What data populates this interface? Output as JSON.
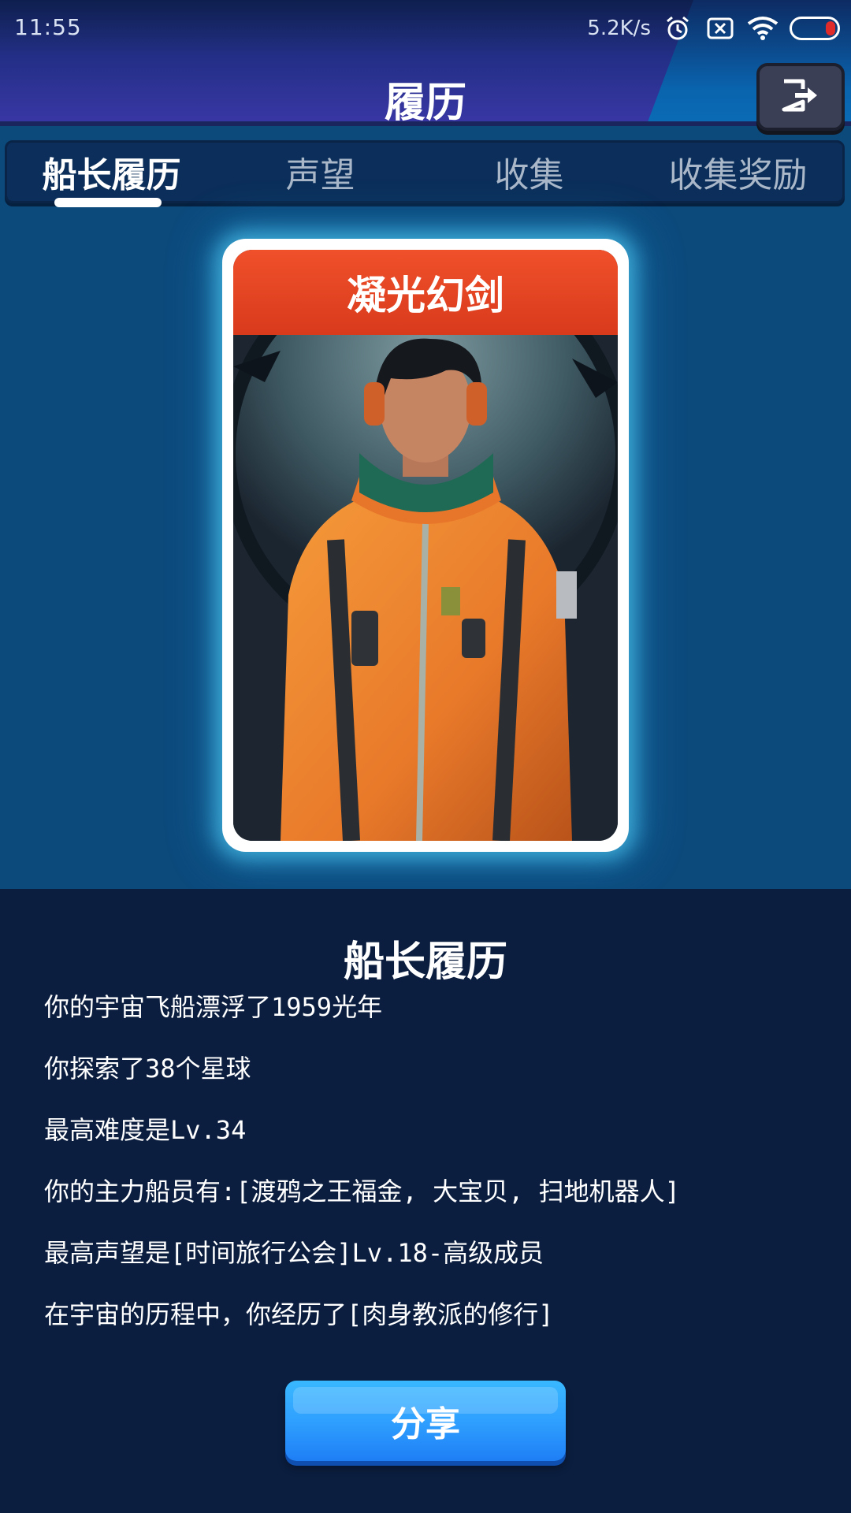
{
  "status_bar": {
    "time": "11:55",
    "net_speed": "5.2K/s",
    "icons": [
      "alarm-icon",
      "sim-off-icon",
      "wifi-icon",
      "battery-icon"
    ]
  },
  "header": {
    "title": "履历",
    "exit_icon": "exit-icon"
  },
  "tabs": [
    {
      "label": "船长履历",
      "active": true
    },
    {
      "label": "声望",
      "active": false
    },
    {
      "label": "收集",
      "active": false
    },
    {
      "label": "收集奖励",
      "active": false
    }
  ],
  "card": {
    "title": "凝光幻剑",
    "image": "captain-portrait"
  },
  "resume": {
    "title": "船长履历",
    "lines": [
      "你的宇宙飞船漂浮了1959光年",
      "你探索了38个星球",
      "最高难度是Lv.34",
      "你的主力船员有:[渡鸦之王福金, 大宝贝, 扫地机器人]",
      "最高声望是[时间旅行公会]Lv.18-高级成员",
      "在宇宙的历程中，你经历了[肉身教派的修行]"
    ]
  },
  "share_button": {
    "label": "分享"
  },
  "colors": {
    "card_title_bg": "#e2441f",
    "panel_bg": "#0b1e3f",
    "body_bg": "#0c4a7c",
    "share_button": "#2fa0ff"
  }
}
